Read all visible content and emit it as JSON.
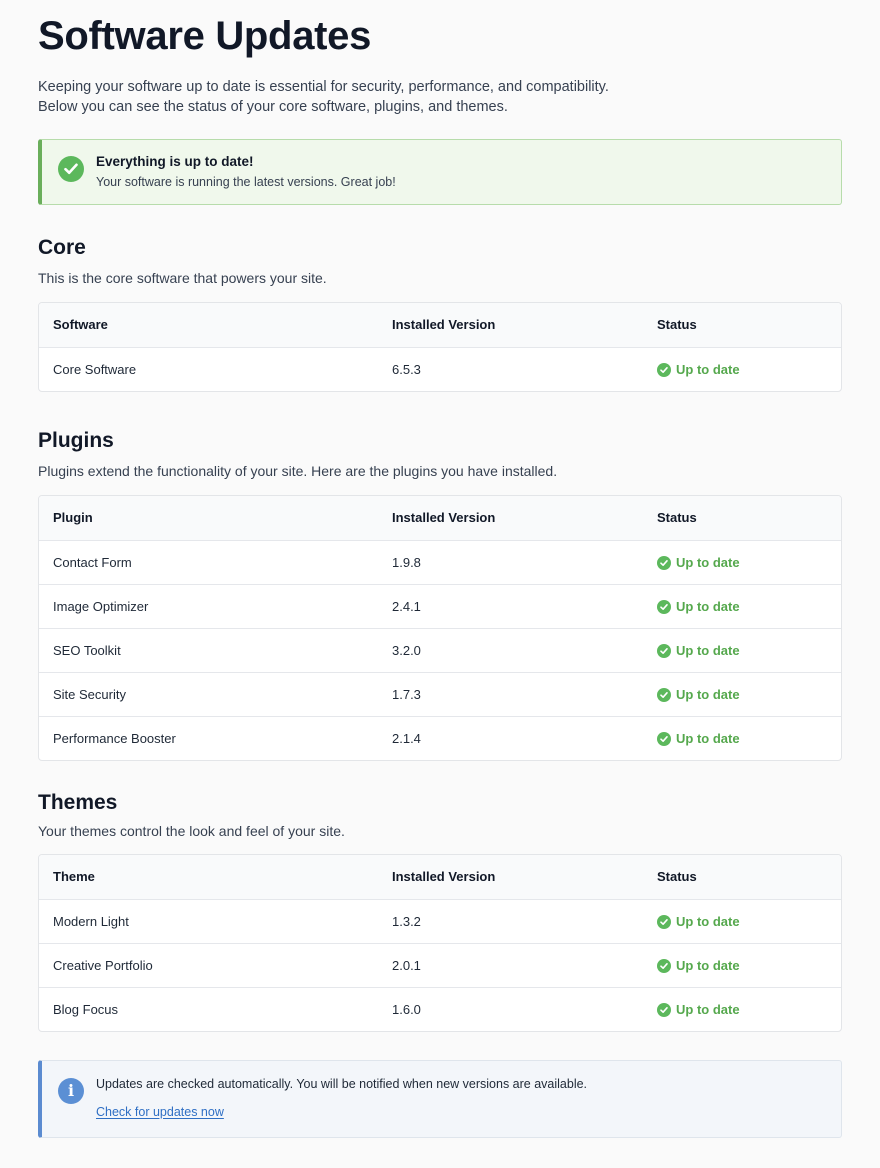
{
  "page": {
    "title": "Software Updates",
    "intro_line1": "Keeping your software up to date is essential for security, performance, and compatibility.",
    "intro_line2": "Below you can see the status of your core software, plugins, and themes."
  },
  "notice": {
    "title": "Everything is up to date!",
    "message": "Your software is running the latest versions. Great job!",
    "icon": "check-circle-icon",
    "color": "#5cb85c"
  },
  "core": {
    "title": "Core",
    "description": "This is the core software that powers your site.",
    "headers": [
      "Software",
      "Installed Version",
      "Status"
    ],
    "rows": [
      {
        "name": "Core Software",
        "version": "6.5.3",
        "status": "Up to date"
      }
    ]
  },
  "plugins": {
    "title": "Plugins",
    "description": "Plugins extend the functionality of your site. Here are the plugins you have installed.",
    "headers": [
      "Plugin",
      "Installed Version",
      "Status"
    ],
    "rows": [
      {
        "name": "Contact Form",
        "version": "1.9.8",
        "status": "Up to date"
      },
      {
        "name": "Image Optimizer",
        "version": "2.4.1",
        "status": "Up to date"
      },
      {
        "name": "SEO Toolkit",
        "version": "3.2.0",
        "status": "Up to date"
      },
      {
        "name": "Site Security",
        "version": "1.7.3",
        "status": "Up to date"
      },
      {
        "name": "Performance Booster",
        "version": "2.1.4",
        "status": "Up to date"
      }
    ]
  },
  "themes": {
    "title": "Themes",
    "description": "Your themes control the look and feel of your site.",
    "headers": [
      "Theme",
      "Installed Version",
      "Status"
    ],
    "rows": [
      {
        "name": "Modern Light",
        "version": "1.3.2",
        "status": "Up to date"
      },
      {
        "name": "Creative Portfolio",
        "version": "2.0.1",
        "status": "Up to date"
      },
      {
        "name": "Blog Focus",
        "version": "1.6.0",
        "status": "Up to date"
      }
    ]
  },
  "info": {
    "message": "Updates are checked automatically. You will be notified when new versions are available.",
    "link_label": "Check for updates now",
    "icon": "info-icon",
    "color": "#5b8fd4"
  },
  "colors": {
    "success": "#5cb85c",
    "status_text": "#55a84d",
    "info_accent": "#5b8bd0",
    "link": "#2f6fc4"
  }
}
